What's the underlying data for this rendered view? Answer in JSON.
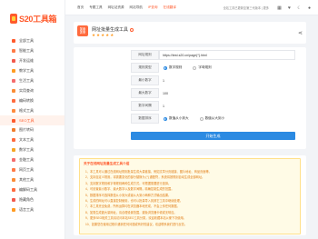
{
  "logo": {
    "text": "S20工具箱"
  },
  "sidebar": {
    "items": [
      {
        "label": "全部工具",
        "color": "#ff5a2c",
        "active": false
      },
      {
        "label": "智能工具",
        "color": "#ff7a45",
        "active": false
      },
      {
        "label": "开发运维",
        "color": "#f2594b",
        "active": false
      },
      {
        "label": "教学工具",
        "color": "#ff9b21",
        "active": false
      },
      {
        "label": "生活工具",
        "color": "#f56c6c",
        "active": false
      },
      {
        "label": "实用查询",
        "color": "#fa8c35",
        "active": false
      },
      {
        "label": "编码转换",
        "color": "#ff6b3d",
        "active": false
      },
      {
        "label": "格式工具",
        "color": "#ff8a3d",
        "active": false
      },
      {
        "label": "SEO工具",
        "color": "#ff5a2c",
        "active": true
      },
      {
        "label": "图片转码",
        "color": "#f07c2a",
        "active": false
      },
      {
        "label": "文本工具",
        "color": "#ff6a3d",
        "active": false
      },
      {
        "label": "数学工具",
        "color": "#f5a623",
        "active": false
      },
      {
        "label": "金融工具",
        "color": "#f56c6c",
        "active": false
      },
      {
        "label": "网页工具",
        "color": "#ff7a45",
        "active": false
      },
      {
        "label": "其他工具",
        "color": "#fa8c35",
        "active": false
      },
      {
        "label": "编解码工具",
        "color": "#ff6b3d",
        "active": false
      },
      {
        "label": "隐藏角色",
        "color": "#f2594b",
        "active": false
      },
      {
        "label": "语言工具",
        "color": "#ff9b21",
        "active": false
      }
    ]
  },
  "topnav": {
    "items": [
      {
        "label": "首页",
        "highlight": false
      },
      {
        "label": "专题工具",
        "highlight": false
      },
      {
        "label": "网址站资源",
        "highlight": false
      },
      {
        "label": "网站导航",
        "highlight": false
      },
      {
        "label": "IP查询",
        "highlight": true
      },
      {
        "label": "在线翻译",
        "highlight": true
      }
    ],
    "notice": "全站工具已更新至第三代版本 | 更多"
  },
  "tool": {
    "title": "网址批量生成工具",
    "rating": 5
  },
  "form": {
    "url_label": "网址规则",
    "url_value": "https://test.s20.cn/page{*}.html",
    "type_label": "规则类型",
    "type_options": [
      "数字规则",
      "字母规则"
    ],
    "start_label": "最小数字",
    "start_value": "1",
    "end_label": "最大数字",
    "end_value": "100",
    "step_label": "数字间隔",
    "step_value": "1",
    "order_label": "数据排序",
    "order_options": [
      "数值从小到大",
      "数值从大到小"
    ],
    "submit_label": "开始生成"
  },
  "help": {
    "title": "关于在线网址批量生成工具介绍",
    "lines": [
      "1、本工具可以通过在线网址规则批量生成大量链接，例如文章分页链接、图片地址、商品页面等。",
      "2、支持自定义规则，将需要变化的部分替换为 {*} 通配符，系统将按规则自动生成全部网址。",
      "3、支持数字规则和字母规则两种生成方式，可根据需要进行选择。",
      "4、可设置最小数字、最大数字以及数字间隔，精确控制生成的范围。",
      "5、数据排序可选择数值从小到大或者从大到小两种方式输出结果。",
      "6、生成的网址可以直接复制使用，也可以批量导入到其它工具中继续处理。",
      "7、本工具完全免费，所有运算均在浏览器本地完成，不会上传任何数据。",
      "8、如需生成超大量网址，请合理设置范围，避免浏览器卡顿或无响应。",
      "9、更多SEO相关工具请访问本站SEO工具分类，欢迎收藏本站以便下次使用。",
      "10、如果您在使用过程中遇到任何问题或有好的建议，欢迎联系我们进行反馈。"
    ]
  }
}
